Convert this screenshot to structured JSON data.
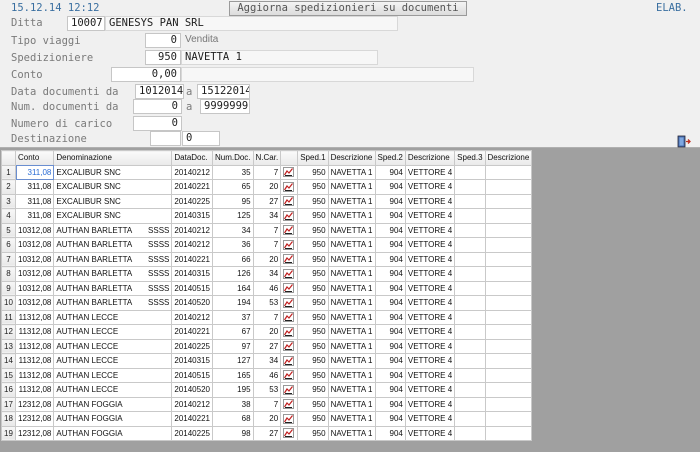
{
  "header": {
    "datetime": "15.12.14 12:12",
    "title": "Aggiorna spedizionieri su documenti",
    "status": "ELAB."
  },
  "form": {
    "ditta": {
      "label": "Ditta",
      "code": "10007",
      "name": "GENESYS PAN SRL"
    },
    "tipo_viaggi": {
      "label": "Tipo viaggi",
      "value": "0",
      "desc": "Vendita"
    },
    "spedizioniere": {
      "label": "Spedizioniere",
      "value": "950",
      "name": "NAVETTA 1"
    },
    "conto": {
      "label": "Conto",
      "value": "0,00"
    },
    "data_documenti": {
      "label": "Data documenti da",
      "from": "1012014",
      "to_label": "a",
      "to": "15122014"
    },
    "num_documenti": {
      "label": "Num. documenti da",
      "from": "0",
      "to_label": "a",
      "to": "9999999"
    },
    "numero_carico": {
      "label": "Numero di carico",
      "value": "0"
    },
    "destinazione": {
      "label": "Destinazione",
      "value": "0"
    }
  },
  "table": {
    "columns": [
      "",
      "Conto",
      "Denominazione",
      "DataDoc.",
      "Num.Doc.",
      "N.Car.",
      "",
      "Sped.1",
      "Descrizione",
      "Sped.2",
      "Descrizione",
      "Sped.3",
      "Descrizione"
    ],
    "rows": [
      [
        "1",
        "311,08",
        "EXCALIBUR SNC",
        "",
        "20140212",
        "35",
        "7",
        "950",
        "NAVETTA 1",
        "904",
        "VETTORE 4",
        "",
        ""
      ],
      [
        "2",
        "311,08",
        "EXCALIBUR SNC",
        "",
        "20140221",
        "65",
        "20",
        "950",
        "NAVETTA 1",
        "904",
        "VETTORE 4",
        "",
        ""
      ],
      [
        "3",
        "311,08",
        "EXCALIBUR SNC",
        "",
        "20140225",
        "95",
        "27",
        "950",
        "NAVETTA 1",
        "904",
        "VETTORE 4",
        "",
        ""
      ],
      [
        "4",
        "311,08",
        "EXCALIBUR SNC",
        "",
        "20140315",
        "125",
        "34",
        "950",
        "NAVETTA 1",
        "904",
        "VETTORE 4",
        "",
        ""
      ],
      [
        "5",
        "10312,08",
        "AUTHAN BARLETTA",
        "SSSS",
        "20140212",
        "34",
        "7",
        "950",
        "NAVETTA 1",
        "904",
        "VETTORE 4",
        "",
        ""
      ],
      [
        "6",
        "10312,08",
        "AUTHAN BARLETTA",
        "SSSS",
        "20140212",
        "36",
        "7",
        "950",
        "NAVETTA 1",
        "904",
        "VETTORE 4",
        "",
        ""
      ],
      [
        "7",
        "10312,08",
        "AUTHAN BARLETTA",
        "SSSS",
        "20140221",
        "66",
        "20",
        "950",
        "NAVETTA 1",
        "904",
        "VETTORE 4",
        "",
        ""
      ],
      [
        "8",
        "10312,08",
        "AUTHAN BARLETTA",
        "SSSS",
        "20140315",
        "126",
        "34",
        "950",
        "NAVETTA 1",
        "904",
        "VETTORE 4",
        "",
        ""
      ],
      [
        "9",
        "10312,08",
        "AUTHAN BARLETTA",
        "SSSS",
        "20140515",
        "164",
        "46",
        "950",
        "NAVETTA 1",
        "904",
        "VETTORE 4",
        "",
        ""
      ],
      [
        "10",
        "10312,08",
        "AUTHAN BARLETTA",
        "SSSS",
        "20140520",
        "194",
        "53",
        "950",
        "NAVETTA 1",
        "904",
        "VETTORE 4",
        "",
        ""
      ],
      [
        "11",
        "11312,08",
        "AUTHAN LECCE",
        "",
        "20140212",
        "37",
        "7",
        "950",
        "NAVETTA 1",
        "904",
        "VETTORE 4",
        "",
        ""
      ],
      [
        "12",
        "11312,08",
        "AUTHAN LECCE",
        "",
        "20140221",
        "67",
        "20",
        "950",
        "NAVETTA 1",
        "904",
        "VETTORE 4",
        "",
        ""
      ],
      [
        "13",
        "11312,08",
        "AUTHAN LECCE",
        "",
        "20140225",
        "97",
        "27",
        "950",
        "NAVETTA 1",
        "904",
        "VETTORE 4",
        "",
        ""
      ],
      [
        "14",
        "11312,08",
        "AUTHAN LECCE",
        "",
        "20140315",
        "127",
        "34",
        "950",
        "NAVETTA 1",
        "904",
        "VETTORE 4",
        "",
        ""
      ],
      [
        "15",
        "11312,08",
        "AUTHAN LECCE",
        "",
        "20140515",
        "165",
        "46",
        "950",
        "NAVETTA 1",
        "904",
        "VETTORE 4",
        "",
        ""
      ],
      [
        "16",
        "11312,08",
        "AUTHAN LECCE",
        "",
        "20140520",
        "195",
        "53",
        "950",
        "NAVETTA 1",
        "904",
        "VETTORE 4",
        "",
        ""
      ],
      [
        "17",
        "12312,08",
        "AUTHAN FOGGIA",
        "",
        "20140212",
        "38",
        "7",
        "950",
        "NAVETTA 1",
        "904",
        "VETTORE 4",
        "",
        ""
      ],
      [
        "18",
        "12312,08",
        "AUTHAN FOGGIA",
        "",
        "20140221",
        "68",
        "20",
        "950",
        "NAVETTA 1",
        "904",
        "VETTORE 4",
        "",
        ""
      ],
      [
        "19",
        "12312,08",
        "AUTHAN FOGGIA",
        "",
        "20140225",
        "98",
        "27",
        "950",
        "NAVETTA 1",
        "904",
        "VETTORE 4",
        "",
        ""
      ]
    ]
  },
  "icons": {
    "row_action": "truck-icon",
    "exit": "exit-door-icon"
  }
}
